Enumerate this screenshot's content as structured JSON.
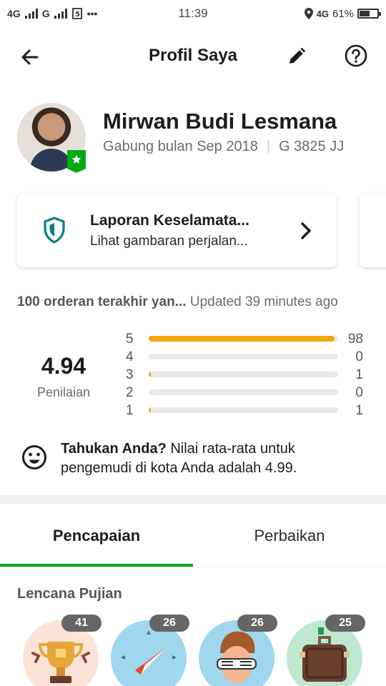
{
  "status_bar": {
    "network_1": "4G",
    "network_2": "G",
    "more": "•••",
    "time": "11:39",
    "data_type": "4G",
    "battery": "61%",
    "battery_level": 0.61
  },
  "header": {
    "title": "Profil Saya",
    "back_icon": "arrow-left-icon",
    "edit_icon": "pencil-icon",
    "help_icon": "question-circle-icon"
  },
  "profile": {
    "name": "Mirwan Budi Lesmana",
    "joined": "Gabung bulan Sep 2018",
    "separator": "|",
    "plate": "G 3825 JJ",
    "badge_icon": "star-badge-icon"
  },
  "safety_card": {
    "title": "Laporan Keselamata...",
    "subtitle": "Lihat gambaran perjalan...",
    "icon": "shield-icon",
    "accent": "#0a7f87"
  },
  "rating": {
    "header_bold": "100 orderan terakhir yan...",
    "header_updated": "Updated 39 minutes ago",
    "average": "4.94",
    "label": "Penilaian",
    "bar_color": "#f2a60c",
    "breakdown": [
      {
        "star": "5",
        "count": "98",
        "fraction": 0.98
      },
      {
        "star": "4",
        "count": "0",
        "fraction": 0.0
      },
      {
        "star": "3",
        "count": "1",
        "fraction": 0.01
      },
      {
        "star": "2",
        "count": "0",
        "fraction": 0.0
      },
      {
        "star": "1",
        "count": "1",
        "fraction": 0.01
      }
    ]
  },
  "tip": {
    "bold": "Tahukan Anda?",
    "text": " Nilai rata-rata untuk pengemudi di kota Anda adalah 4.99.",
    "icon": "smiley-icon"
  },
  "tabs": [
    {
      "label": "Pencapaian",
      "active": true
    },
    {
      "label": "Perbaikan",
      "active": false
    }
  ],
  "tab_accent": "#00aa13",
  "compliments": {
    "title": "Lencana Pujian",
    "items": [
      {
        "count": "41",
        "icon": "trophy-icon",
        "bg": "#fbe3d6"
      },
      {
        "count": "26",
        "icon": "compass-icon",
        "bg": "#9fd7ee"
      },
      {
        "count": "26",
        "icon": "cool-person-icon",
        "bg": "#9fd7ee"
      },
      {
        "count": "25",
        "icon": "suitcase-icon",
        "bg": "#bfe8d0"
      }
    ]
  }
}
